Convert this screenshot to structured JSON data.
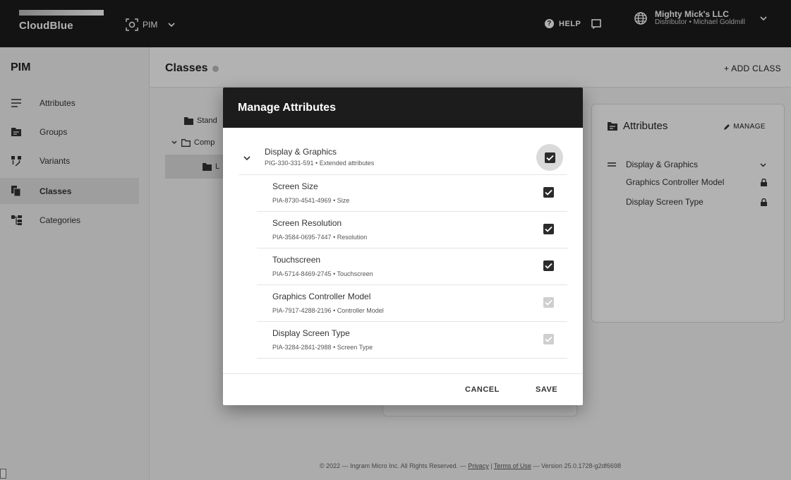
{
  "topbar": {
    "logo": "CloudBlue",
    "module": "PIM",
    "help": "HELP",
    "account_name": "Mighty Mick's LLC",
    "account_role": "Distributor • Michael Goldmill"
  },
  "sidebar": {
    "title": "PIM",
    "items": [
      {
        "label": "Attributes",
        "icon": "list-icon"
      },
      {
        "label": "Groups",
        "icon": "group-icon"
      },
      {
        "label": "Variants",
        "icon": "variants-icon"
      },
      {
        "label": "Classes",
        "icon": "classes-icon"
      },
      {
        "label": "Categories",
        "icon": "categories-icon"
      }
    ]
  },
  "main": {
    "title": "Classes",
    "add_class": "+ ADD CLASS",
    "tree": [
      "Stand",
      "Comp",
      "L"
    ],
    "panel": {
      "title": "Attributes",
      "manage": "MANAGE",
      "group": "Display & Graphics",
      "items": [
        "Graphics Controller Model",
        "Display Screen Type"
      ]
    },
    "footer": {
      "prefix": "© 2022 — Ingram Micro Inc. All Rights Reserved. —",
      "privacy": "Privacy",
      "sep": "|",
      "terms": "Terms of Use",
      "version": "— Version 25.0.1728-g2df6698"
    }
  },
  "dialog": {
    "title": "Manage Attributes",
    "group": {
      "name": "Display & Graphics",
      "sub": "PIG-330-331-591 • Extended attributes",
      "checked": true
    },
    "attributes": [
      {
        "name": "Screen Size",
        "sub": "PIA-8730-4541-4969 • Size",
        "checked": true,
        "disabled": false
      },
      {
        "name": "Screen Resolution",
        "sub": "PIA-3584-0695-7447 • Resolution",
        "checked": true,
        "disabled": false
      },
      {
        "name": "Touchscreen",
        "sub": "PIA-5714-8469-2745 • Touchscreen",
        "checked": true,
        "disabled": false
      },
      {
        "name": "Graphics Controller Model",
        "sub": "PIA-7917-4288-2196 • Controller Model",
        "checked": true,
        "disabled": true
      },
      {
        "name": "Display Screen Type",
        "sub": "PIA-3284-2841-2988 • Screen Type",
        "checked": true,
        "disabled": true
      }
    ],
    "cancel": "CANCEL",
    "save": "SAVE"
  }
}
